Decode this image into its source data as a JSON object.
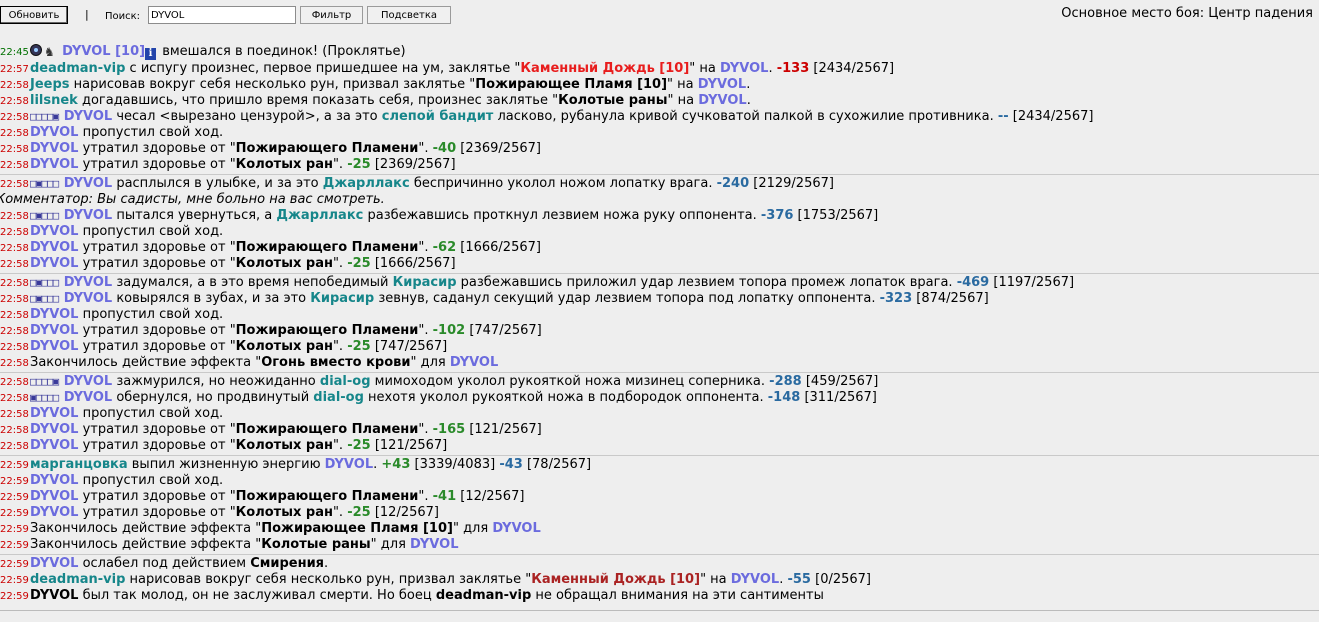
{
  "toolbar": {
    "refresh_label": "Обновить",
    "separator": "|",
    "search_label": "Поиск:",
    "search_value": "DYVOL",
    "filter_label": "Фильтр",
    "highlight_label": "Подсветка"
  },
  "battle_place": "Основное место боя: Центр падения",
  "log": [
    {
      "time": "22:45",
      "segs": [
        {
          "t": " "
        },
        {
          "t": "DYVOL [10]",
          "c": "n-blue"
        },
        {
          "t": " вмешался в поединок! (Проклятье)"
        }
      ]
    },
    {
      "time": "22:57",
      "segs": [
        {
          "t": "deadman-vip",
          "c": "n-teal"
        },
        {
          "t": " с испугу произнес, первое пришедшее на ум, заклятье \""
        },
        {
          "t": "Каменный Дождь [10]",
          "c": "red"
        },
        {
          "t": "\" на "
        },
        {
          "t": "DYVOL",
          "c": "n-blue"
        },
        {
          "t": ". "
        },
        {
          "t": "-133",
          "c": "dmg"
        },
        {
          "t": " [2434/2567]"
        }
      ]
    },
    {
      "time": "22:58",
      "segs": [
        {
          "t": "Jeeps",
          "c": "n-teal"
        },
        {
          "t": " нарисовав вокруг себя несколько рун, призвал заклятье \""
        },
        {
          "t": "Пожирающее Пламя [10]",
          "c": "b"
        },
        {
          "t": "\" на "
        },
        {
          "t": "DYVOL",
          "c": "n-blue"
        },
        {
          "t": "."
        }
      ]
    },
    {
      "time": "22:58",
      "segs": [
        {
          "t": "lilsnek",
          "c": "n-teal"
        },
        {
          "t": " догадавшись, что пришло время показать себя, произнес заклятье \""
        },
        {
          "t": "Колотые раны",
          "c": "b"
        },
        {
          "t": "\" на "
        },
        {
          "t": "DYVOL",
          "c": "n-blue"
        },
        {
          "t": "."
        }
      ]
    },
    {
      "time": "22:58",
      "segs": [
        {
          "t": "□□□□▣ ",
          "c": "squares"
        },
        {
          "t": "DYVOL",
          "c": "n-blue"
        },
        {
          "t": " чесал <вырезано цензурой>, а за это "
        },
        {
          "t": "слепой бандит",
          "c": "n-teal"
        },
        {
          "t": " ласково, рубанула кривой сучковатой палкой в сухожилие противника. "
        },
        {
          "t": "--",
          "c": "dash"
        },
        {
          "t": " [2434/2567]"
        }
      ]
    },
    {
      "time": "22:58",
      "segs": [
        {
          "t": "DYVOL",
          "c": "n-blue"
        },
        {
          "t": " пропустил свой ход."
        }
      ]
    },
    {
      "time": "22:58",
      "segs": [
        {
          "t": "DYVOL",
          "c": "n-blue"
        },
        {
          "t": " утратил здоровье от \""
        },
        {
          "t": "Пожирающего Пламени",
          "c": "b"
        },
        {
          "t": "\". "
        },
        {
          "t": "-40",
          "c": "heal"
        },
        {
          "t": " [2369/2567]"
        }
      ]
    },
    {
      "time": "22:58",
      "segs": [
        {
          "t": "DYVOL",
          "c": "n-blue"
        },
        {
          "t": " утратил здоровье от \""
        },
        {
          "t": "Колотых ран",
          "c": "b"
        },
        {
          "t": "\". "
        },
        {
          "t": "-25",
          "c": "heal"
        },
        {
          "t": " [2369/2567]"
        }
      ]
    },
    {
      "sep": true
    },
    {
      "time": "22:58",
      "segs": [
        {
          "t": "□▣□□□ ",
          "c": "squares"
        },
        {
          "t": "DYVOL",
          "c": "n-blue"
        },
        {
          "t": " расплылся в улыбке, и за это "
        },
        {
          "t": "Джарллакс",
          "c": "n-teal"
        },
        {
          "t": " беспричинно уколол ножом лопатку врага. "
        },
        {
          "t": "-240",
          "c": "dmg-blue"
        },
        {
          "t": " [2129/2567]"
        }
      ]
    },
    {
      "comment": "Комментатор: Вы садисты, мне больно на вас смотреть."
    },
    {
      "time": "22:58",
      "segs": [
        {
          "t": "□▣□□□ ",
          "c": "squares"
        },
        {
          "t": "DYVOL",
          "c": "n-blue"
        },
        {
          "t": " пытался увернуться, а "
        },
        {
          "t": "Джарллакс",
          "c": "n-teal"
        },
        {
          "t": " разбежавшись проткнул лезвием ножа руку оппонента. "
        },
        {
          "t": "-376",
          "c": "dmg-blue"
        },
        {
          "t": " [1753/2567]"
        }
      ]
    },
    {
      "time": "22:58",
      "segs": [
        {
          "t": "DYVOL",
          "c": "n-blue"
        },
        {
          "t": " пропустил свой ход."
        }
      ]
    },
    {
      "time": "22:58",
      "segs": [
        {
          "t": "DYVOL",
          "c": "n-blue"
        },
        {
          "t": " утратил здоровье от \""
        },
        {
          "t": "Пожирающего Пламени",
          "c": "b"
        },
        {
          "t": "\". "
        },
        {
          "t": "-62",
          "c": "heal"
        },
        {
          "t": " [1666/2567]"
        }
      ]
    },
    {
      "time": "22:58",
      "segs": [
        {
          "t": "DYVOL",
          "c": "n-blue"
        },
        {
          "t": " утратил здоровье от \""
        },
        {
          "t": "Колотых ран",
          "c": "b"
        },
        {
          "t": "\". "
        },
        {
          "t": "-25",
          "c": "heal"
        },
        {
          "t": " [1666/2567]"
        }
      ]
    },
    {
      "sep": true
    },
    {
      "time": "22:58",
      "segs": [
        {
          "t": "□▣□□□ ",
          "c": "squares"
        },
        {
          "t": "DYVOL",
          "c": "n-blue"
        },
        {
          "t": " задумался, а в это время непобедимый "
        },
        {
          "t": "Кирасир",
          "c": "n-teal"
        },
        {
          "t": " разбежавшись приложил удар лезвием топора промеж лопаток врага. "
        },
        {
          "t": "-469",
          "c": "dmg-blue"
        },
        {
          "t": " [1197/2567]"
        }
      ]
    },
    {
      "time": "22:58",
      "segs": [
        {
          "t": "□▣□□□ ",
          "c": "squares"
        },
        {
          "t": "DYVOL",
          "c": "n-blue"
        },
        {
          "t": " ковырялся в зубах, и за это "
        },
        {
          "t": "Кирасир",
          "c": "n-teal"
        },
        {
          "t": " зевнув, саданул секущий удар лезвием топора под лопатку оппонента. "
        },
        {
          "t": "-323",
          "c": "dmg-blue"
        },
        {
          "t": " [874/2567]"
        }
      ]
    },
    {
      "time": "22:58",
      "segs": [
        {
          "t": "DYVOL",
          "c": "n-blue"
        },
        {
          "t": " пропустил свой ход."
        }
      ]
    },
    {
      "time": "22:58",
      "segs": [
        {
          "t": "DYVOL",
          "c": "n-blue"
        },
        {
          "t": " утратил здоровье от \""
        },
        {
          "t": "Пожирающего Пламени",
          "c": "b"
        },
        {
          "t": "\". "
        },
        {
          "t": "-102",
          "c": "heal"
        },
        {
          "t": " [747/2567]"
        }
      ]
    },
    {
      "time": "22:58",
      "segs": [
        {
          "t": "DYVOL",
          "c": "n-blue"
        },
        {
          "t": " утратил здоровье от \""
        },
        {
          "t": "Колотых ран",
          "c": "b"
        },
        {
          "t": "\". "
        },
        {
          "t": "-25",
          "c": "heal"
        },
        {
          "t": " [747/2567]"
        }
      ]
    },
    {
      "time": "22:58",
      "segs": [
        {
          "t": "Закончилось действие эффекта \""
        },
        {
          "t": "Огонь вместо крови",
          "c": "b"
        },
        {
          "t": "\" для "
        },
        {
          "t": "DYVOL",
          "c": "n-blue"
        }
      ]
    },
    {
      "sep": true
    },
    {
      "time": "22:58",
      "segs": [
        {
          "t": "□□□□▣ ",
          "c": "squares"
        },
        {
          "t": "DYVOL",
          "c": "n-blue"
        },
        {
          "t": " зажмурился, но неожиданно "
        },
        {
          "t": "dial-og",
          "c": "n-teal"
        },
        {
          "t": " мимоходом уколол рукояткой ножа мизинец соперника. "
        },
        {
          "t": "-288",
          "c": "dmg-blue"
        },
        {
          "t": " [459/2567]"
        }
      ]
    },
    {
      "time": "22:58",
      "segs": [
        {
          "t": "▣□□□□ ",
          "c": "squares"
        },
        {
          "t": "DYVOL",
          "c": "n-blue"
        },
        {
          "t": " обернулся, но продвинутый "
        },
        {
          "t": "dial-og",
          "c": "n-teal"
        },
        {
          "t": " нехотя уколол рукояткой ножа в подбородок оппонента. "
        },
        {
          "t": "-148",
          "c": "dmg-blue"
        },
        {
          "t": " [311/2567]"
        }
      ]
    },
    {
      "time": "22:58",
      "segs": [
        {
          "t": "DYVOL",
          "c": "n-blue"
        },
        {
          "t": " пропустил свой ход."
        }
      ]
    },
    {
      "time": "22:58",
      "segs": [
        {
          "t": "DYVOL",
          "c": "n-blue"
        },
        {
          "t": " утратил здоровье от \""
        },
        {
          "t": "Пожирающего Пламени",
          "c": "b"
        },
        {
          "t": "\". "
        },
        {
          "t": "-165",
          "c": "heal"
        },
        {
          "t": " [121/2567]"
        }
      ]
    },
    {
      "time": "22:58",
      "segs": [
        {
          "t": "DYVOL",
          "c": "n-blue"
        },
        {
          "t": " утратил здоровье от \""
        },
        {
          "t": "Колотых ран",
          "c": "b"
        },
        {
          "t": "\". "
        },
        {
          "t": "-25",
          "c": "heal"
        },
        {
          "t": " [121/2567]"
        }
      ]
    },
    {
      "sep": true
    },
    {
      "time": "22:59",
      "segs": [
        {
          "t": "марганцовка",
          "c": "n-teal"
        },
        {
          "t": " выпил жизненную энергию "
        },
        {
          "t": "DYVOL",
          "c": "n-blue"
        },
        {
          "t": ". "
        },
        {
          "t": "+43",
          "c": "heal"
        },
        {
          "t": " [3339/4083] "
        },
        {
          "t": "-43",
          "c": "dmg-blue"
        },
        {
          "t": " [78/2567]"
        }
      ]
    },
    {
      "time": "22:59",
      "segs": [
        {
          "t": "DYVOL",
          "c": "n-blue"
        },
        {
          "t": " пропустил свой ход."
        }
      ]
    },
    {
      "time": "22:59",
      "segs": [
        {
          "t": "DYVOL",
          "c": "n-blue"
        },
        {
          "t": " утратил здоровье от \""
        },
        {
          "t": "Пожирающего Пламени",
          "c": "b"
        },
        {
          "t": "\". "
        },
        {
          "t": "-41",
          "c": "heal"
        },
        {
          "t": " [12/2567]"
        }
      ]
    },
    {
      "time": "22:59",
      "segs": [
        {
          "t": "DYVOL",
          "c": "n-blue"
        },
        {
          "t": " утратил здоровье от \""
        },
        {
          "t": "Колотых ран",
          "c": "b"
        },
        {
          "t": "\". "
        },
        {
          "t": "-25",
          "c": "heal"
        },
        {
          "t": " [12/2567]"
        }
      ]
    },
    {
      "time": "22:59",
      "segs": [
        {
          "t": "Закончилось действие эффекта \""
        },
        {
          "t": "Пожирающее Пламя [10]",
          "c": "b"
        },
        {
          "t": "\" для "
        },
        {
          "t": "DYVOL",
          "c": "n-blue"
        }
      ]
    },
    {
      "time": "22:59",
      "segs": [
        {
          "t": "Закончилось действие эффекта \""
        },
        {
          "t": "Колотые раны",
          "c": "b"
        },
        {
          "t": "\" для "
        },
        {
          "t": "DYVOL",
          "c": "n-blue"
        }
      ]
    },
    {
      "sep": true
    },
    {
      "time": "22:59",
      "segs": [
        {
          "t": "DYVOL",
          "c": "n-blue"
        },
        {
          "t": " ослабел под действием "
        },
        {
          "t": "Смирения",
          "c": "b"
        },
        {
          "t": "."
        }
      ]
    },
    {
      "time": "22:59",
      "segs": [
        {
          "t": "deadman-vip",
          "c": "n-teal"
        },
        {
          "t": " нарисовав вокруг себя несколько рун, призвал заклятье \""
        },
        {
          "t": "Каменный Дождь [10]",
          "c": "darkred"
        },
        {
          "t": "\" на "
        },
        {
          "t": "DYVOL",
          "c": "n-blue"
        },
        {
          "t": ". "
        },
        {
          "t": "-55",
          "c": "dmg-blue"
        },
        {
          "t": " [0/2567]"
        }
      ]
    },
    {
      "time": "22:59",
      "segs": [
        {
          "t": "DYVOL",
          "c": "b"
        },
        {
          "t": " был так молод, он не заслуживал смерти. Но боец "
        },
        {
          "t": "deadman-vip",
          "c": "b"
        },
        {
          "t": " не обращал внимания на эти сантименты"
        }
      ]
    }
  ]
}
